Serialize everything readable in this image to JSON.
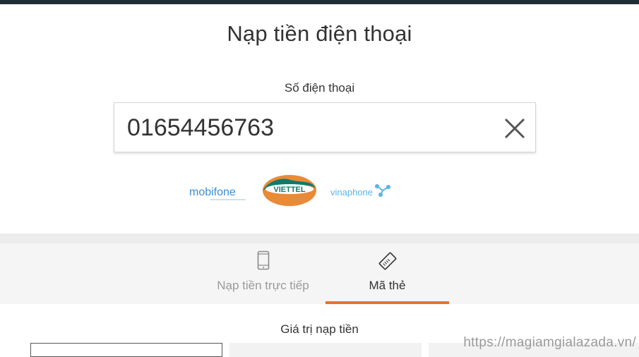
{
  "header": {
    "title": "Nạp tiền điện thoại"
  },
  "phone": {
    "label": "Số điện thoại",
    "value": "01654456763",
    "clear_icon": "close-icon"
  },
  "carriers": [
    {
      "name": "mobifone",
      "text": "mobifone"
    },
    {
      "name": "viettel",
      "text": "VIETTEL"
    },
    {
      "name": "vinaphone",
      "text": "vinaphone"
    }
  ],
  "tabs": [
    {
      "label": "Nạp tiền trực tiếp",
      "icon": "mobile-phone-icon",
      "active": false
    },
    {
      "label": "Mã thẻ",
      "icon": "card-icon",
      "active": true
    }
  ],
  "topup": {
    "label": "Giá trị nạp tiền"
  },
  "watermark": "https://magiamgialazada.vn/",
  "colors": {
    "accent": "#e6732b",
    "topbar": "#1f2d35"
  }
}
